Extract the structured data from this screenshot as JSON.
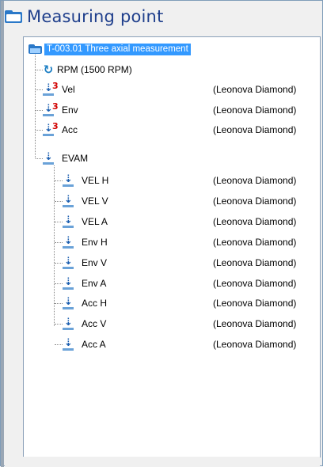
{
  "header": {
    "title": "Measuring point"
  },
  "tree": {
    "root": "T-003.01  Three axial measurement",
    "rpm": {
      "label": "RPM   (1500 RPM)"
    },
    "points": [
      {
        "label": "Vel",
        "device": "(Leonova Diamond)",
        "badge": "3"
      },
      {
        "label": "Env",
        "device": "(Leonova Diamond)",
        "badge": "3"
      },
      {
        "label": "Acc",
        "device": "(Leonova Diamond)",
        "badge": "3"
      }
    ],
    "evam": {
      "label": "EVAM",
      "children": [
        {
          "label": "VEL H",
          "device": "(Leonova Diamond)"
        },
        {
          "label": "VEL V",
          "device": "(Leonova Diamond)"
        },
        {
          "label": "VEL A",
          "device": "(Leonova Diamond)"
        },
        {
          "label": "Env H",
          "device": "(Leonova Diamond)"
        },
        {
          "label": "Env V",
          "device": "(Leonova Diamond)"
        },
        {
          "label": "Env A",
          "device": "(Leonova Diamond)"
        },
        {
          "label": "Acc H",
          "device": "(Leonova Diamond)"
        },
        {
          "label": "Acc V",
          "device": "(Leonova Diamond)"
        },
        {
          "label": "Acc A",
          "device": "(Leonova Diamond)"
        }
      ]
    }
  }
}
